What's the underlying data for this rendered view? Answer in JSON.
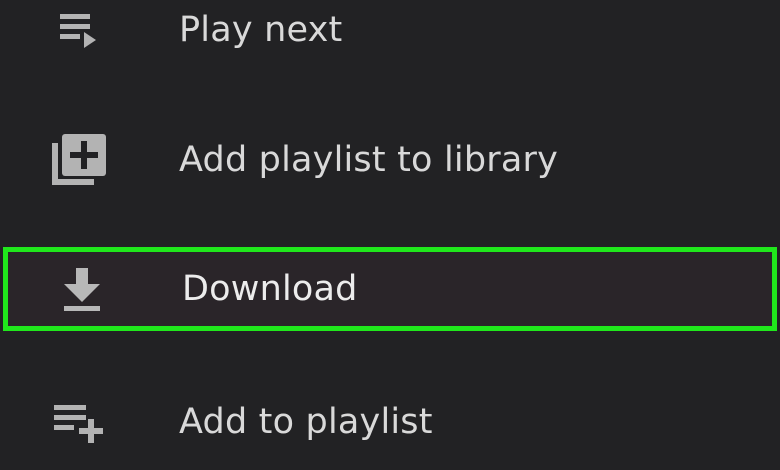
{
  "menu": {
    "items": [
      {
        "label": "Play next",
        "icon": "play-next-icon"
      },
      {
        "label": "Add playlist to library",
        "icon": "library-add-icon"
      },
      {
        "label": "Download",
        "icon": "download-icon",
        "highlighted": true
      },
      {
        "label": "Add to playlist",
        "icon": "playlist-add-icon"
      }
    ],
    "highlight_color": "#20e81c"
  }
}
